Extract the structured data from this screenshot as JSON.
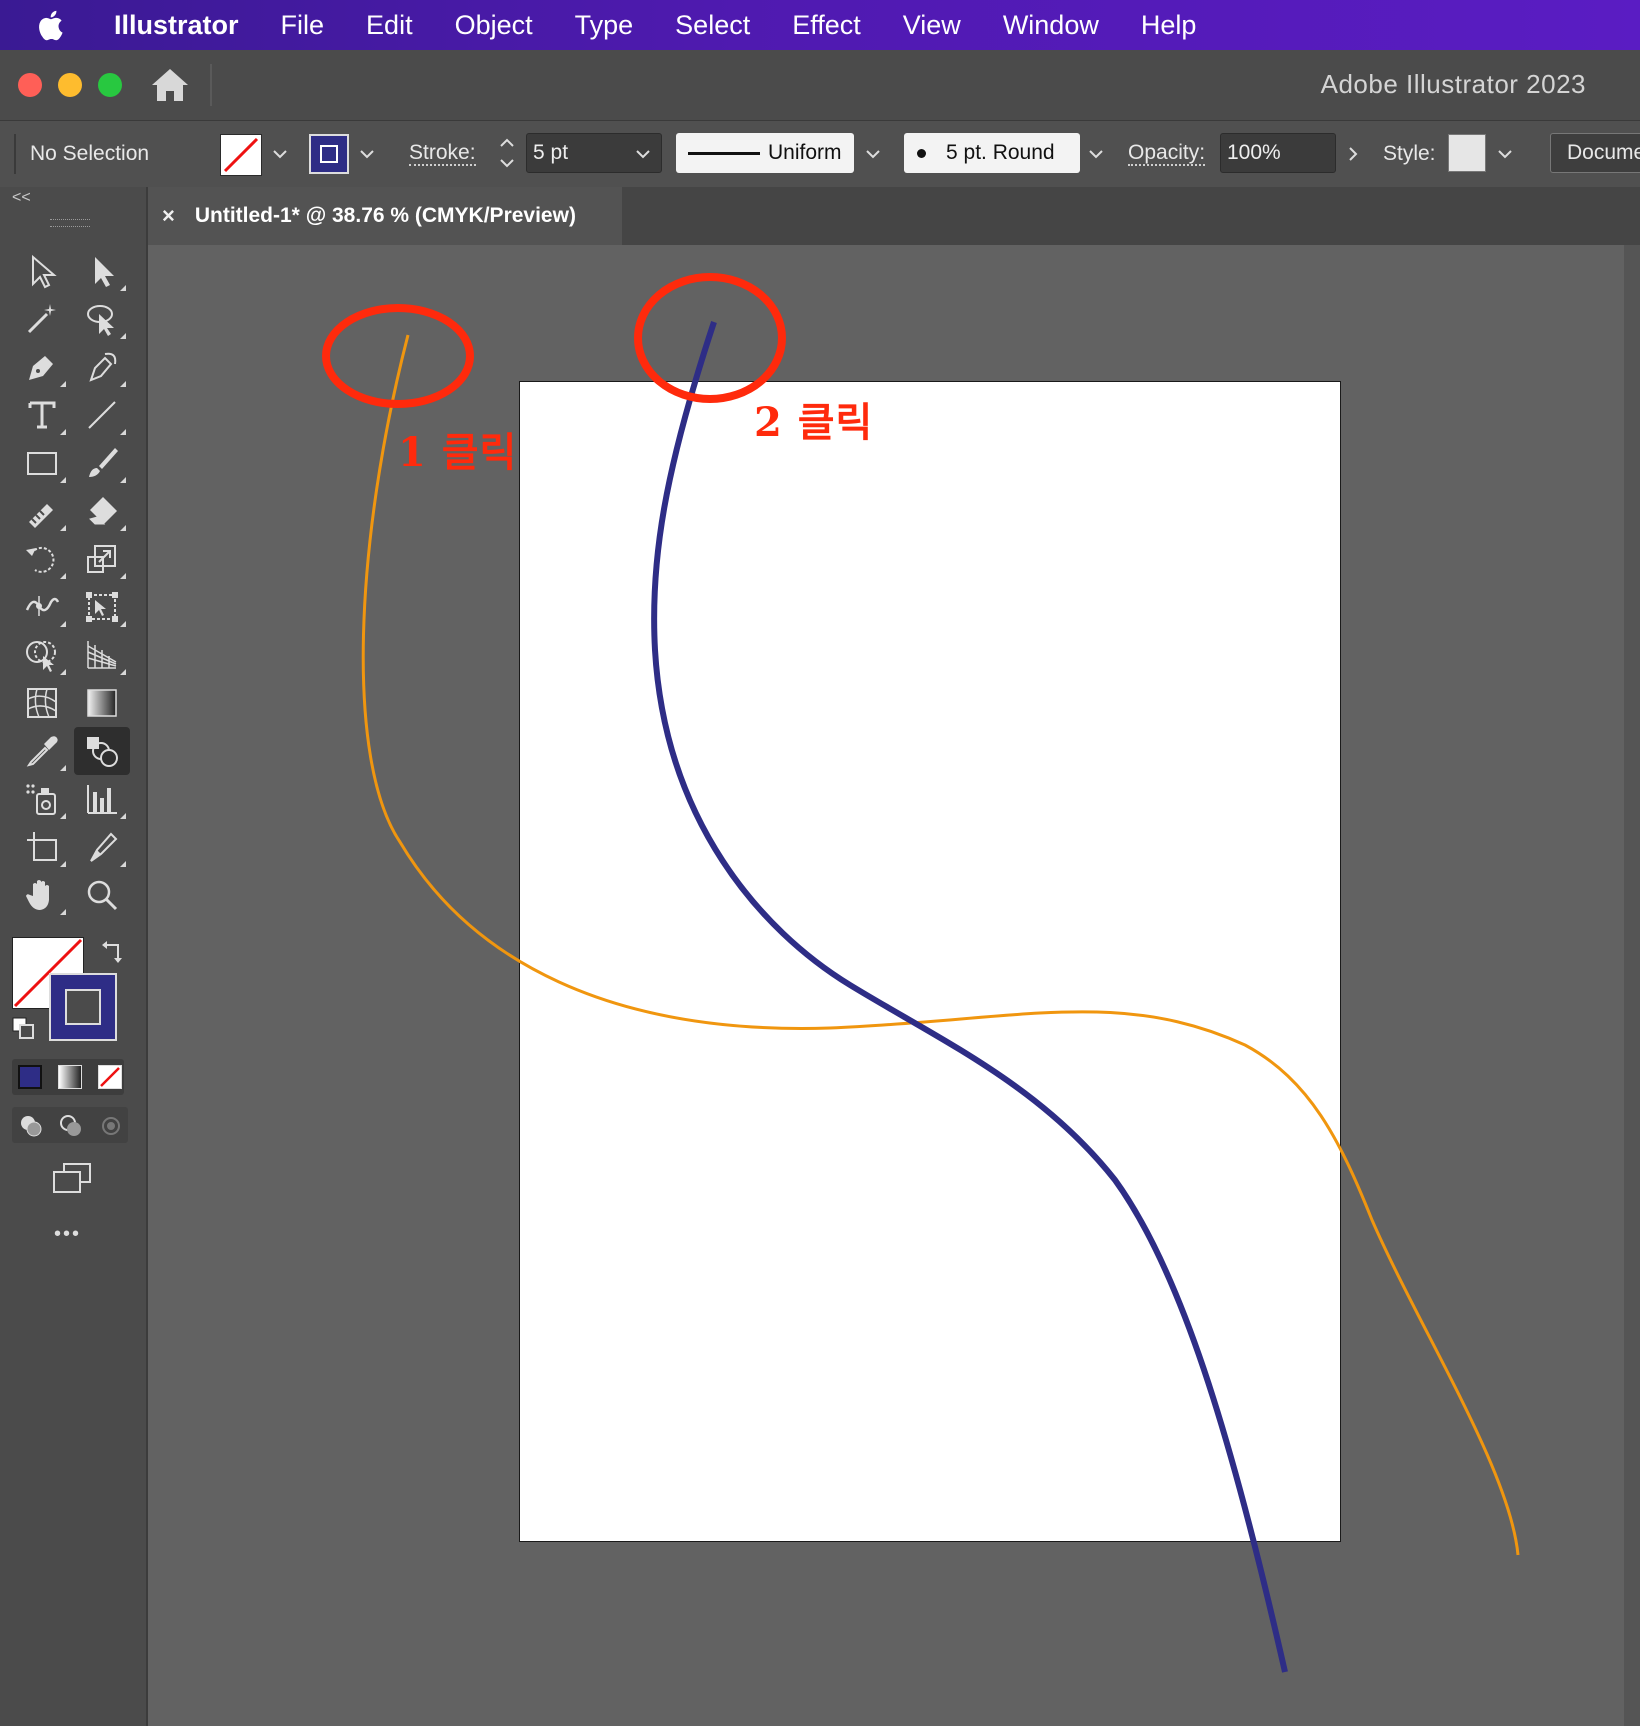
{
  "menubar": {
    "app_name": "Illustrator",
    "items": [
      "File",
      "Edit",
      "Object",
      "Type",
      "Select",
      "Effect",
      "View",
      "Window",
      "Help"
    ]
  },
  "window": {
    "title": "Adobe Illustrator 2023"
  },
  "control_bar": {
    "selection_status": "No Selection",
    "stroke_label": "Stroke:",
    "stroke_weight": "5 pt",
    "variable_width_profile": "Uniform",
    "brush_definition": "5 pt. Round",
    "opacity_label": "Opacity:",
    "opacity_value": "100%",
    "style_label": "Style:",
    "document_setup_label": "Docume"
  },
  "document_tab": {
    "close_glyph": "×",
    "title": "Untitled-1* @ 38.76 % (CMYK/Preview)"
  },
  "tool_panel": {
    "collapse_glyph": "<<",
    "more_tools_glyph": "•••"
  },
  "annotations": {
    "label_1": "1 클릭",
    "label_2": "2 클릭"
  },
  "colors": {
    "menubar_start": "#3a1a93",
    "menubar_end": "#5a1cc3",
    "orange_path": "#f0960f",
    "navy_path": "#2e2d86",
    "annotation_red": "#ff2a0c",
    "stroke_swatch": "#2e2d86",
    "traffic_close": "#ff5f57",
    "traffic_minimize": "#febc2e",
    "traffic_zoom": "#28c840"
  }
}
